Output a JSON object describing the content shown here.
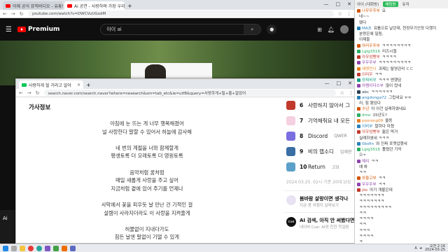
{
  "yt": {
    "tabs": [
      "이제 공식 뮤직비디오 - 유튜브 뮤직",
      "Ai 공연 - 사랑하며 가장 우리"
    ],
    "url": "youtube.com/watch?v=DWCVuUGodM",
    "brand": "Premium",
    "search": "아이 ai",
    "side": "Ai"
  },
  "nv": {
    "tab": "사랑하게 될 거라고 알아",
    "url": "search.naver.com/search.naver?where=nexearch&sm=tab_etc&ie=utf8&query=사랑하게+될+줄+알았어",
    "lyrics_header": "가사정보",
    "lyrics": [
      "아침에 눈 뜨는 게 너무 행복해졌어",
      "널 사랑한다 말할 수 있어서 하늘에 감사해",
      "",
      "네 번의 계절을 너와 함께할게",
      "평생토록 더 오래토록 더 영원토록",
      "",
      "음악처럼 꿈처럼",
      "매일 새롭게 사랑을 주고 싶어",
      "지금처럼 곁에 있어 주기를 언제나",
      "",
      "사막에서 꽃을 피우듯 날 만난 건 기적인 걸",
      "설렘이 사라지더라도 이 사랑을 지켜줄게",
      "",
      "허물없이 지내다가도",
      "힘든 날엔 말없이 기댈 수 있게"
    ],
    "ranks": [
      {
        "num": "6",
        "title": "사랑하지 않아서 그",
        "artist": "",
        "color": "#c0392b"
      },
      {
        "num": "7",
        "title": "기억해줘요 내 모든",
        "artist": "",
        "color": "#f5d0e0"
      },
      {
        "num": "8",
        "title": "Discord",
        "artist": "QWER",
        "color": "#7a6ee0"
      },
      {
        "num": "9",
        "title": "비의 랩소디",
        "artist": "임재현",
        "color": "#3a6ea5"
      },
      {
        "num": "10",
        "title": "Return",
        "artist": "고요",
        "color": "#5aa0c8"
      }
    ],
    "rank_note": "2024.03.25. 02시 기준 20대 남성",
    "cards": [
      {
        "title": "봄바람 살랑이면 생각나",
        "sub": "지금 봄 여행지 살펴보기",
        "icon": ""
      },
      {
        "title": "AI 검색, 아직 안 써봤다면",
        "sub": "네이버 Cue: AI와 친한 첫걸음",
        "icon": "cue"
      }
    ]
  },
  "chat": {
    "tabs": [
      "아이 (대화방)",
      "채팅방",
      "유저"
    ],
    "messages": [
      {
        "nick": "나무우주부",
        "text": "요",
        "color": "#d35400"
      },
      {
        "nick": "",
        "text": "네~~",
        "color": "#333"
      },
      {
        "nick": "",
        "text": "됐다",
        "color": "#333"
      },
      {
        "nick": "MA초",
        "text": "유튭으로 날던데, 현장무기인정 다했지",
        "color": "#2980b9"
      },
      {
        "nick": "",
        "text": "분량은에 밀림,",
        "color": "#333"
      },
      {
        "nick": "",
        "text": "이제들",
        "color": "#333"
      },
      {
        "nick": "아리우주부",
        "text": "ㅋㅋㅋㅋㅋㅋㅋㅋ",
        "color": "#d35400"
      },
      {
        "nick": "Lgig3516",
        "text": "리즈시절",
        "color": "#27ae60"
      },
      {
        "nick": "아우엄빵부",
        "text": "ㅋㅋㅋㅋ",
        "color": "#c0392b"
      },
      {
        "nick": "무우주부",
        "text": "ㅋㅋㅋㅋㅋㅋㅋㅋㅋ",
        "color": "#8e44ad"
      },
      {
        "nick": "세영언니",
        "text": "과제는 탈영관리 ㄷㄷ",
        "color": "#e67e22"
      },
      {
        "nick": "이리우",
        "text": "ㅋㅋ",
        "color": "#c0392b"
      },
      {
        "nick": "양찌비부",
        "text": "ㅋㅋㅋ 앤했담",
        "color": "#16a085"
      },
      {
        "nick": "아렘이다스부",
        "text": "많이 컸네",
        "color": "#8e44ad"
      },
      {
        "nick": "abc",
        "text": "ㅋㅋㅋㅋㅋㅋ",
        "color": "#2c3e50"
      },
      {
        "nick": "angdonga72",
        "text": "그립네요 ㅠㅠ",
        "color": "#2980b9"
      },
      {
        "nick": "",
        "text": "리, 힘 됐었다",
        "color": "#333"
      },
      {
        "nick": "수년",
        "text": "아 이건 실례하였네요",
        "color": "#d35400"
      },
      {
        "nick": "dmo",
        "text": "15년도?",
        "color": "#27ae60"
      },
      {
        "nick": "poorong09",
        "text": "율동",
        "color": "#e67e22"
      },
      {
        "nick": "이비부",
        "text": "말하다 미쳤",
        "color": "#2980b9"
      },
      {
        "nick": "아우엄빵부",
        "text": "젊은 먹거",
        "color": "#c0392b"
      },
      {
        "nick": "",
        "text": "실례하였네 ㅋㅋㅋ",
        "color": "#333"
      },
      {
        "nick": "0bsfin",
        "text": "와 진짜 포맷업했네",
        "color": "#2980b9"
      },
      {
        "nick": "Lgig3516",
        "text": "틀렸던 기억",
        "color": "#27ae60"
      },
      {
        "nick": "",
        "text": "으ㅜ",
        "color": "#333"
      },
      {
        "nick": "제리",
        "text": "ㅋㅋ",
        "color": "#8e44ad"
      },
      {
        "nick": "",
        "text": "얘 봐",
        "color": "#333"
      },
      {
        "nick": "",
        "text": "ㅋㅋ",
        "color": "#333"
      },
      {
        "nick": "와울고부",
        "text": "ㅋㅋ",
        "color": "#d35400"
      },
      {
        "nick": "무우주부",
        "text": "ㅋㅋ",
        "color": "#8e44ad"
      },
      {
        "nick": "jilo",
        "text": "아기 개불은데",
        "color": "#c0392b"
      },
      {
        "nick": "",
        "text": "ㅋㅋㅋㅋㅋㅋㅋ",
        "color": "#333"
      },
      {
        "nick": "",
        "text": "ㅋㅋㅋㅋㅋㅋㅋ",
        "color": "#333"
      },
      {
        "nick": "",
        "text": "ㅋㅋㅋㅋㅋㅋㅋㅋㅋ",
        "color": "#333"
      },
      {
        "nick": "",
        "text": "ㅋㅋ",
        "color": "#333"
      },
      {
        "nick": "",
        "text": "ㅋㅋㅋㅋ",
        "color": "#333"
      },
      {
        "nick": "",
        "text": "ㅋㅋ",
        "color": "#333"
      },
      {
        "nick": "",
        "text": "ㅋㅋㅋ",
        "color": "#333"
      },
      {
        "nick": "",
        "text": "ㅋㅋㅋㅋ",
        "color": "#333"
      },
      {
        "nick": "",
        "text": "ㅋ",
        "color": "#333"
      }
    ]
  },
  "taskbar": {
    "time": "오전 2:14",
    "date": "2024-03-25",
    "lang": "A"
  }
}
